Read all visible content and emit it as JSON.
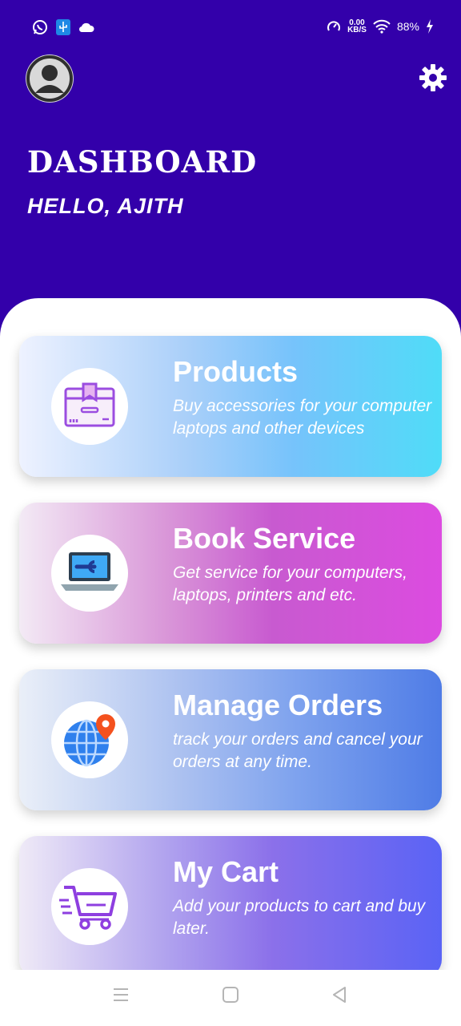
{
  "status_bar": {
    "net_value": "0.00",
    "net_unit": "KB/S",
    "battery": "88%",
    "icons": [
      "whatsapp-icon",
      "usb-debug-icon",
      "cloud-icon",
      "speed-icon",
      "wifi-icon",
      "charging-icon"
    ]
  },
  "header": {
    "title": "DASHBOARD",
    "greeting": "HELLO, AJITH"
  },
  "cards": [
    {
      "title": "Products",
      "description": "Buy accessories for your computer laptops and other devices",
      "icon": "package-box-icon"
    },
    {
      "title": "Book Service",
      "description": "Get service for your computers, laptops, printers and etc.",
      "icon": "laptop-wrench-icon"
    },
    {
      "title": "Manage Orders",
      "description": "track your orders and cancel your orders at any time.",
      "icon": "globe-location-icon"
    },
    {
      "title": "My Cart",
      "description": "Add your products to cart and buy later.",
      "icon": "shopping-cart-icon"
    }
  ],
  "colors": {
    "header_bg": "#3300aa",
    "products_gradient": [
      "#eef2ff",
      "#8ec5fb",
      "#4fdcf8"
    ],
    "service_gradient": [
      "#f3eaf5",
      "#c85ad0",
      "#dc4be0"
    ],
    "orders_gradient": [
      "#eaeff8",
      "#7fa3ee",
      "#4f7ce6"
    ],
    "cart_gradient": [
      "#efeaf7",
      "#8b70ea",
      "#5a63f5"
    ]
  }
}
